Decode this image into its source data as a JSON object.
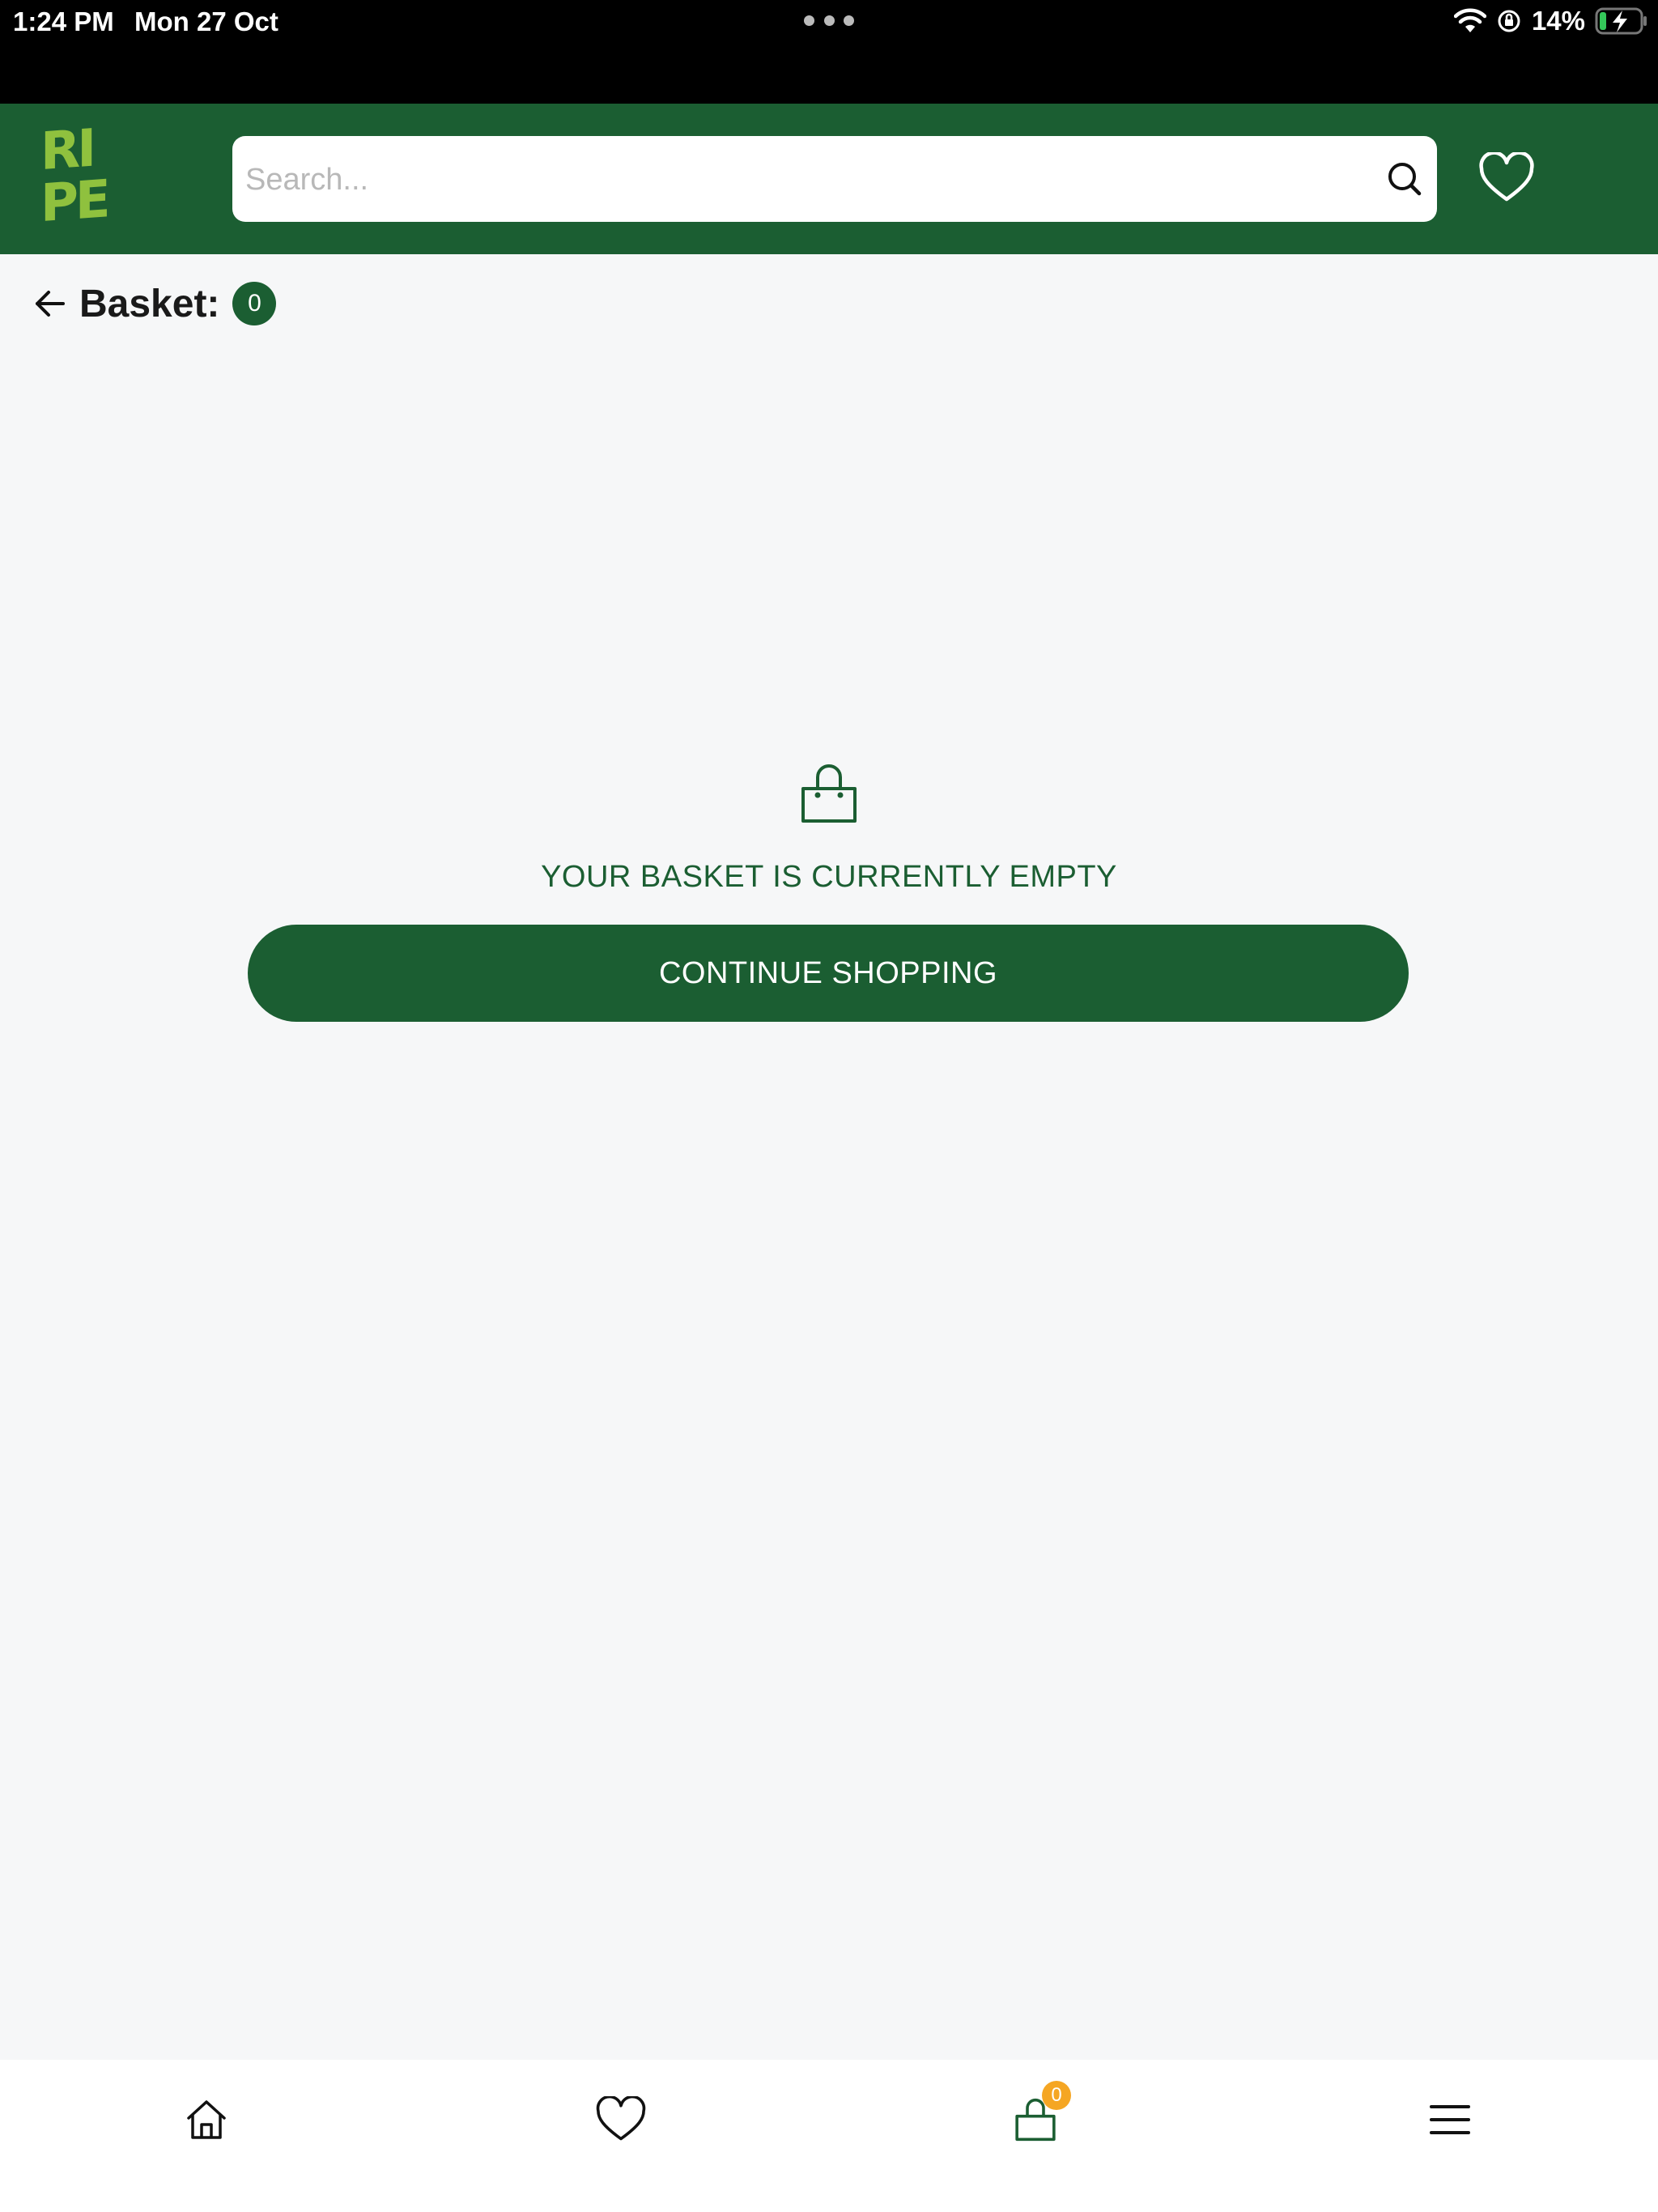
{
  "status_bar": {
    "time": "1:24 PM",
    "date": "Mon 27 Oct",
    "battery": "14%",
    "icons": [
      "wifi-icon",
      "orientation-lock-icon",
      "battery-charging-icon"
    ]
  },
  "header": {
    "logo_lines": [
      "RI",
      "PE"
    ],
    "search_placeholder": "Search...",
    "icons": [
      "search-icon",
      "heart-icon"
    ]
  },
  "basket": {
    "title": "Basket:",
    "count": "0",
    "empty_message": "YOUR BASKET IS CURRENTLY EMPTY",
    "continue_label": "CONTINUE SHOPPING",
    "icons": [
      "back-arrow-icon",
      "shopping-bag-icon"
    ]
  },
  "bottom_nav": {
    "basket_badge": "0",
    "icons": [
      "home-icon",
      "heart-icon",
      "shopping-bag-icon",
      "menu-icon"
    ]
  },
  "colors": {
    "brand_green": "#1b5e32",
    "logo_green": "#8fc13e",
    "badge_orange": "#f5a623",
    "background": "#f6f7f8"
  }
}
